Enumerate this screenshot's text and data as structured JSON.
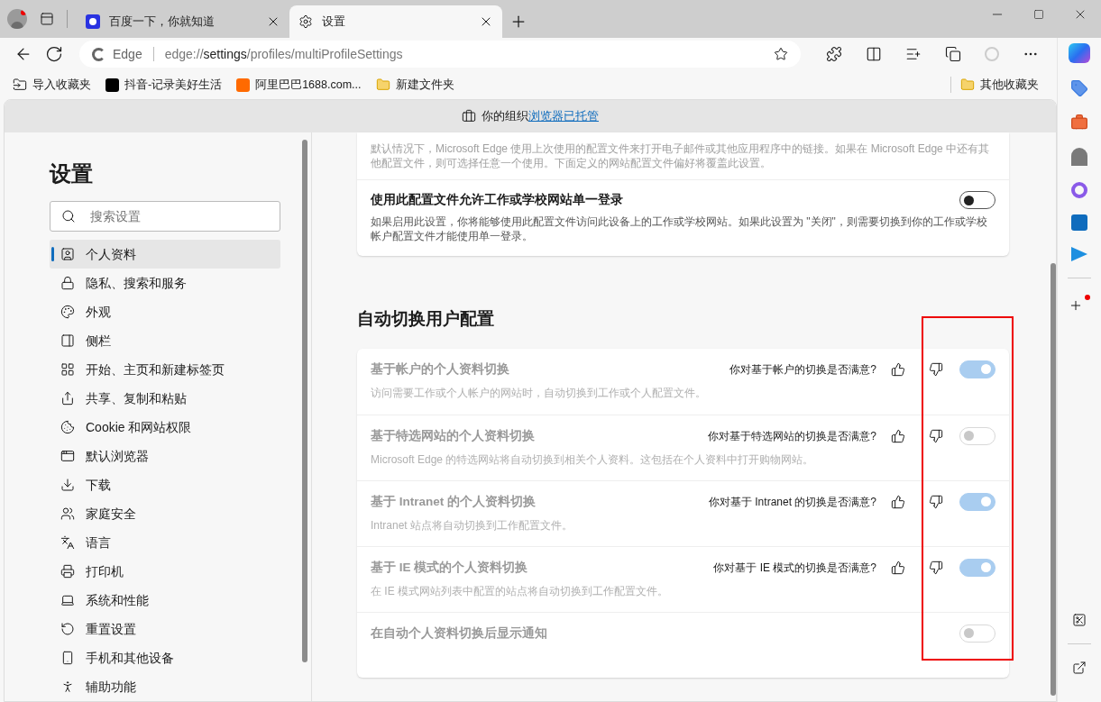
{
  "tabs": [
    {
      "title": "百度一下，你就知道",
      "selected": false
    },
    {
      "title": "设置",
      "selected": true
    }
  ],
  "address_bar": {
    "site_label": "Edge",
    "url_prefix": "edge://",
    "url_strong": "settings",
    "url_rest": "/profiles/multiProfileSettings"
  },
  "bookmarks": [
    {
      "label": "导入收藏夹"
    },
    {
      "label": "抖音-记录美好生活"
    },
    {
      "label": "阿里巴巴1688.com..."
    },
    {
      "label": "新建文件夹"
    }
  ],
  "other_bookmarks": "其他收藏夹",
  "managed_banner": {
    "text": "你的组织",
    "link": "浏览器已托管"
  },
  "sidebar": {
    "title": "设置",
    "search": {
      "placeholder": "搜索设置"
    },
    "items": [
      {
        "label": "个人资料",
        "selected": true
      },
      {
        "label": "隐私、搜索和服务",
        "selected": false
      },
      {
        "label": "外观",
        "selected": false
      },
      {
        "label": "侧栏",
        "selected": false
      },
      {
        "label": "开始、主页和新建标签页",
        "selected": false
      },
      {
        "label": "共享、复制和粘贴",
        "selected": false
      },
      {
        "label": "Cookie 和网站权限",
        "selected": false
      },
      {
        "label": "默认浏览器",
        "selected": false
      },
      {
        "label": "下载",
        "selected": false
      },
      {
        "label": "家庭安全",
        "selected": false
      },
      {
        "label": "语言",
        "selected": false
      },
      {
        "label": "打印机",
        "selected": false
      },
      {
        "label": "系统和性能",
        "selected": false
      },
      {
        "label": "重置设置",
        "selected": false
      },
      {
        "label": "手机和其他设备",
        "selected": false
      },
      {
        "label": "辅助功能",
        "selected": false
      }
    ]
  },
  "top_card": {
    "partial_description": "默认情况下，Microsoft Edge 使用上次使用的配置文件来打开电子邮件或其他应用程序中的链接。如果在 Microsoft Edge 中还有其他配置文件，则可选择任意一个使用。下面定义的网站配置文件偏好将覆盖此设置。",
    "setting": {
      "title": "使用此配置文件允许工作或学校网站单一登录",
      "description": "如果启用此设置，你将能够使用此配置文件访问此设备上的工作或学校网站。如果此设置为 \"关闭\"，则需要切换到你的工作或学校帐户配置文件才能使用单一登录。",
      "on": false,
      "disabled": false
    }
  },
  "auto_switch": {
    "heading": "自动切换用户配置",
    "settings": [
      {
        "title": "基于帐户的个人资料切换",
        "description": "访问需要工作或个人帐户的网站时，自动切换到工作或个人配置文件。",
        "feedback": "你对基于帐户的切换是否满意?",
        "on": true,
        "disabled": true
      },
      {
        "title": "基于特选网站的个人资料切换",
        "description": "Microsoft Edge 的特选网站将自动切换到相关个人资料。这包括在个人资料中打开购物网站。",
        "feedback": "你对基于特选网站的切换是否满意?",
        "on": false,
        "disabled": true
      },
      {
        "title": "基于 Intranet 的个人资料切换",
        "description": "Intranet 站点将自动切换到工作配置文件。",
        "feedback": "你对基于 Intranet 的切换是否满意?",
        "on": true,
        "disabled": true
      },
      {
        "title": "基于 IE 模式的个人资料切换",
        "description": "在 IE 模式网站列表中配置的站点将自动切换到工作配置文件。",
        "feedback": "你对基于 IE 模式的切换是否满意?",
        "on": true,
        "disabled": true
      },
      {
        "title": "在自动个人资料切换后显示通知",
        "on": false,
        "disabled": true
      }
    ]
  }
}
